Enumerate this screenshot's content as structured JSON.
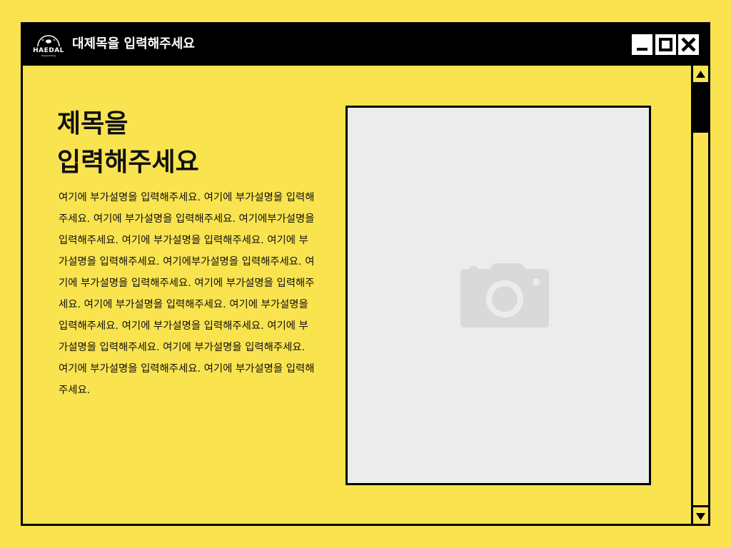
{
  "app": {
    "logo_name": "HAEDAL",
    "logo_sub": "Programming"
  },
  "window": {
    "title": "대제목을 입력해주세요",
    "controls": {
      "minimize_icon": "minimize-icon",
      "maximize_icon": "maximize-icon",
      "close_icon": "close-icon"
    }
  },
  "main": {
    "heading_line1": "제목을",
    "heading_line2": "입력해주세요",
    "body": "여기에 부가설명을 입력해주세요. 여기에 부가설명을 입력해주세요. 여기에 부가설명을 입력해주세요. 여기에부가설명을 입력해주세요. 여기에 부가설명을 입력해주세요. 여기에 부가설명을 입력해주세요. 여기에부가설명을 입력해주세요. 여기에 부가설명을 입력해주세요. 여기에 부가설명을 입력해주세요. 여기에 부가설명을 입력해주세요. 여기에 부가설명을 입력해주세요. 여기에 부가설명을 입력해주세요. 여기에 부가설명을 입력해주세요. 여기에 부가설명을 입력해주세요. 여기에 부가설명을 입력해주세요. 여기에 부가설명을 입력해주세요.",
    "image_placeholder_icon": "camera-icon"
  },
  "scrollbar": {
    "up_icon": "triangle-up-icon",
    "down_icon": "triangle-down-icon"
  },
  "colors": {
    "background": "#f9e34f",
    "titlebar": "#000000",
    "placeholder_bg": "#ececec",
    "placeholder_icon": "#d9d9d9"
  }
}
